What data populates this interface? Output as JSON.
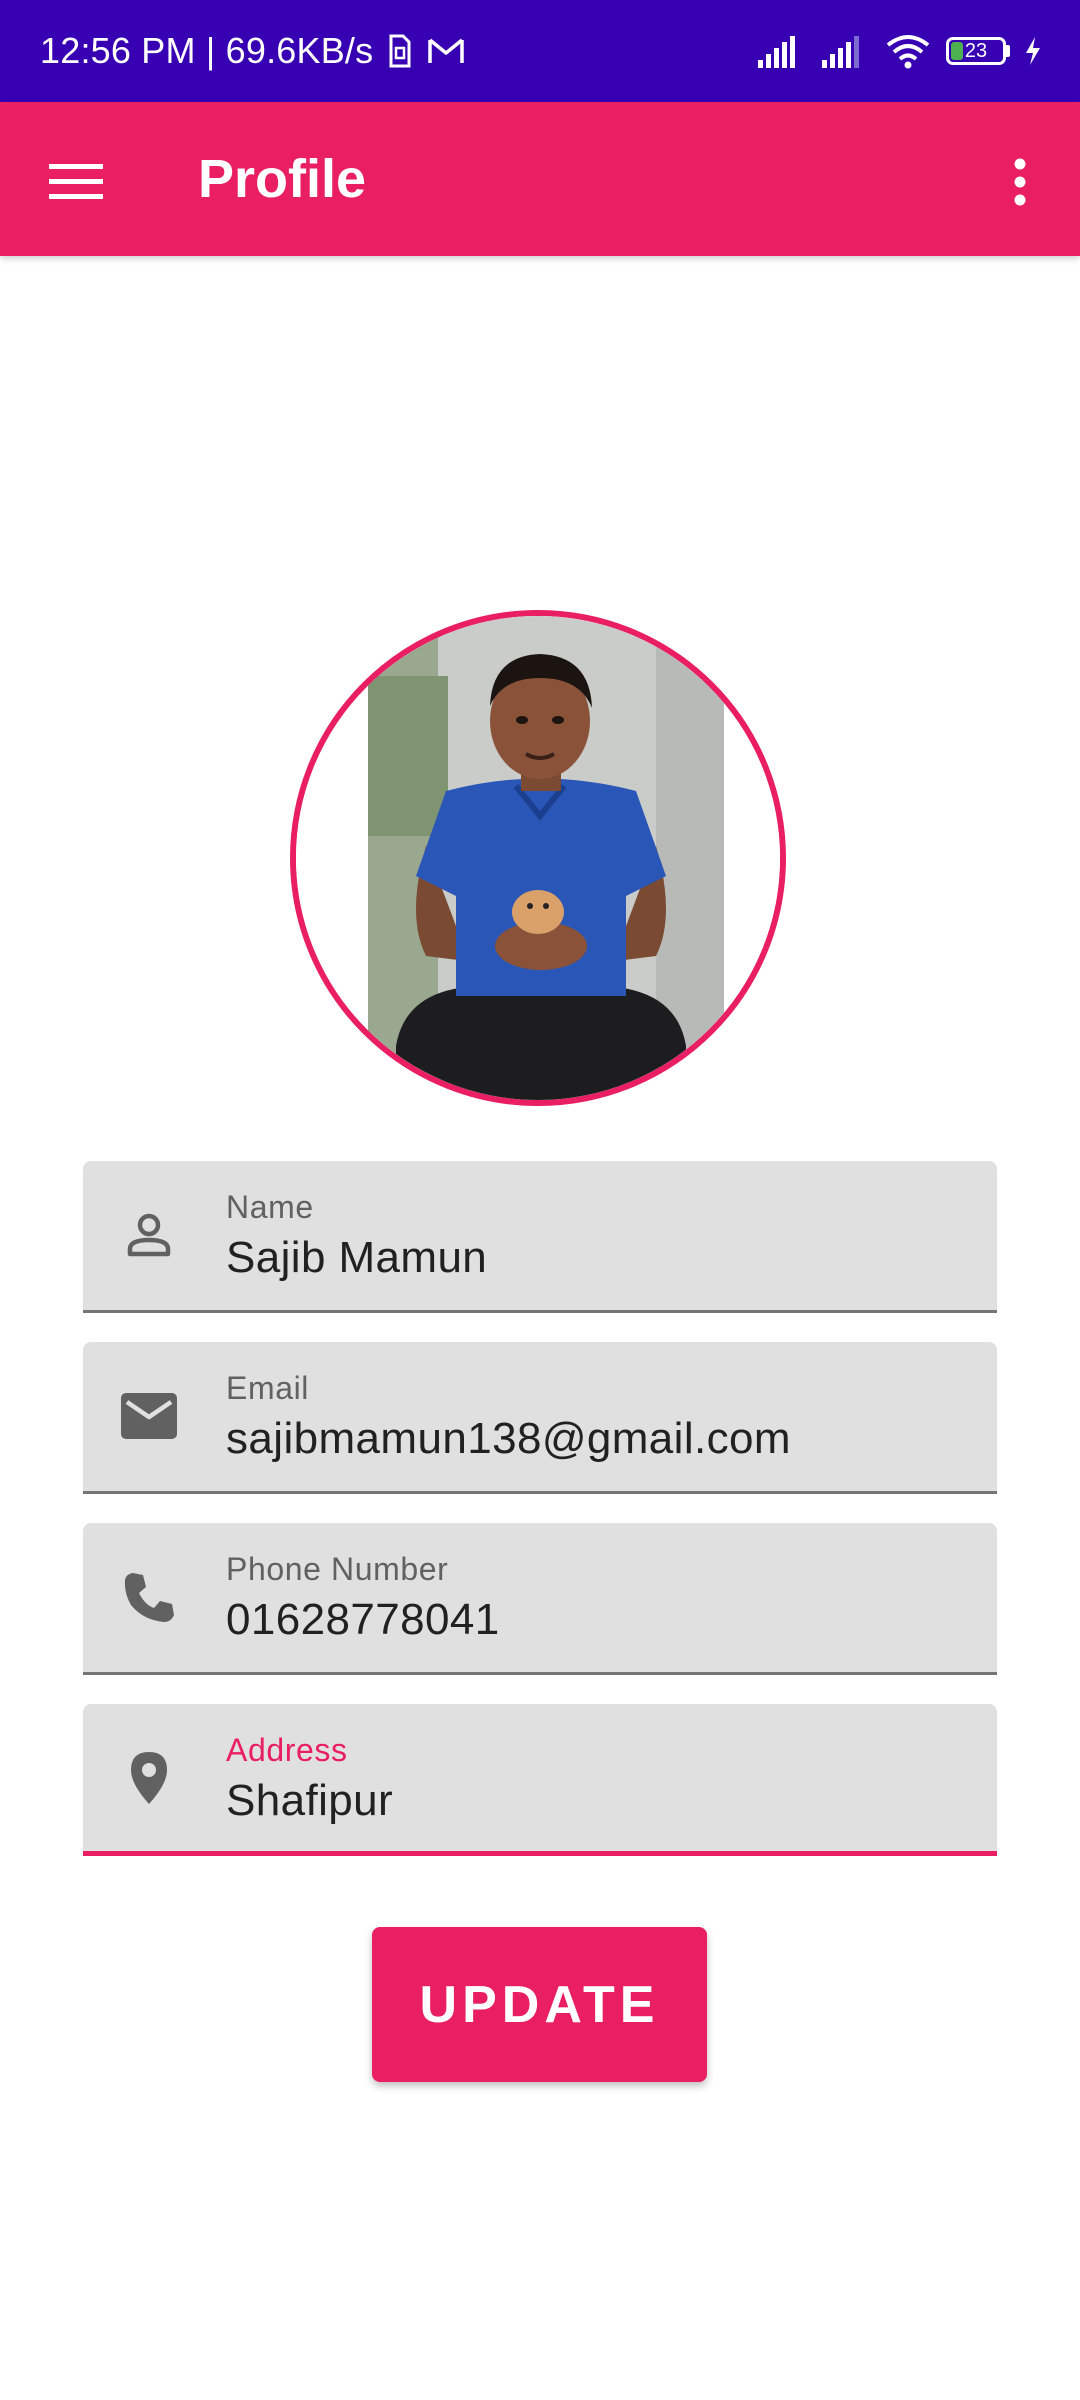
{
  "status_bar": {
    "time_speed": "12:56 PM | 69.6KB/s",
    "battery_level": "23",
    "icons": [
      "sim-icon",
      "gmail-icon",
      "signal-icon",
      "signal-icon",
      "wifi-icon",
      "battery-icon",
      "charging-icon"
    ]
  },
  "app_bar": {
    "title": "Profile",
    "menu_icon": "hamburger-menu-icon",
    "more_icon": "more-vert-icon"
  },
  "profile": {
    "avatar": "profile-photo"
  },
  "form": {
    "name": {
      "label": "Name",
      "value": "Sajib Mamun",
      "icon": "person-icon"
    },
    "email": {
      "label": "Email",
      "value": "sajibmamun138@gmail.com",
      "icon": "email-icon"
    },
    "phone": {
      "label": "Phone Number",
      "value": "01628778041",
      "icon": "phone-icon"
    },
    "address": {
      "label": "Address",
      "value": "Shafipur",
      "icon": "location-pin-icon",
      "focused": true
    }
  },
  "actions": {
    "update_label": "UPDATE"
  },
  "colors": {
    "status_bar": "#3700b3",
    "primary": "#e91e63",
    "field_bg": "#e0e0e0",
    "battery_fill": "#4caf50"
  }
}
